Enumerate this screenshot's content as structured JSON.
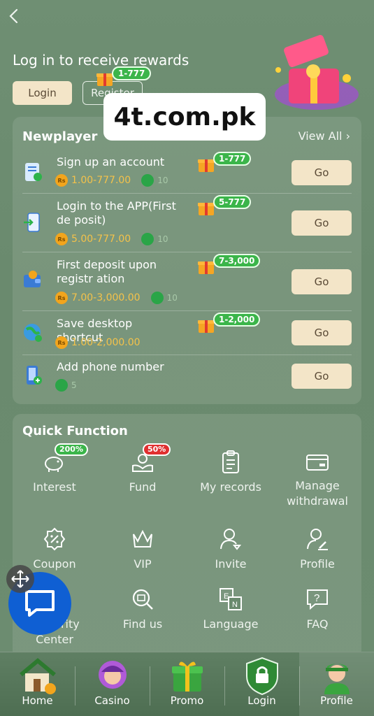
{
  "header": {
    "back_icon": "chevron-left-icon",
    "title": "Log in to receive rewards",
    "login_label": "Login",
    "register_label": "Register",
    "reward_badge": "1-777"
  },
  "watermark": "4t.com.pk",
  "newplayer": {
    "title": "Newplayer",
    "view_all": "View All",
    "tasks": [
      {
        "name": "Sign up an account",
        "amount": "1.00-777.00",
        "badge": "1-777",
        "go": "Go",
        "gem_value": "10"
      },
      {
        "name": "Login to the APP(First de posit)",
        "amount": "5.00-777.00",
        "badge": "5-777",
        "go": "Go",
        "gem_value": "10"
      },
      {
        "name": "First deposit upon registr ation",
        "amount": "7.00-3,000.00",
        "badge": "7-3,000",
        "go": "Go",
        "gem_value": "10"
      },
      {
        "name": "Save desktop shortcut",
        "amount": "1.00-2,000.00",
        "badge": "1-2,000",
        "go": "Go",
        "gem_value": ""
      },
      {
        "name": "Add phone number",
        "amount": "",
        "badge": "",
        "go": "Go",
        "gem_value": "5"
      }
    ],
    "currency_symbol": "Rs"
  },
  "quick_function": {
    "title": "Quick Function",
    "items": [
      {
        "label": "Interest",
        "badge": "200%"
      },
      {
        "label": "Fund",
        "badge": "50%"
      },
      {
        "label": "My records"
      },
      {
        "label": "Manage withdrawal"
      },
      {
        "label": "Coupon"
      },
      {
        "label": "VIP"
      },
      {
        "label": "Invite"
      },
      {
        "label": "Profile"
      },
      {
        "label": "Security Center"
      },
      {
        "label": "Find us"
      },
      {
        "label": "Language"
      },
      {
        "label": "FAQ"
      }
    ]
  },
  "tabbar": {
    "tabs": [
      {
        "label": "Home"
      },
      {
        "label": "Casino"
      },
      {
        "label": "Promo"
      },
      {
        "label": "Login"
      },
      {
        "label": "Profile"
      }
    ],
    "active_tab": "Profile"
  },
  "colors": {
    "accent_button": "#f3e5c8",
    "badge_green": "#3bb54a",
    "badge_red": "#e03030",
    "amount_gold": "#f4c24a",
    "chat_blue": "#0f5fd3"
  }
}
